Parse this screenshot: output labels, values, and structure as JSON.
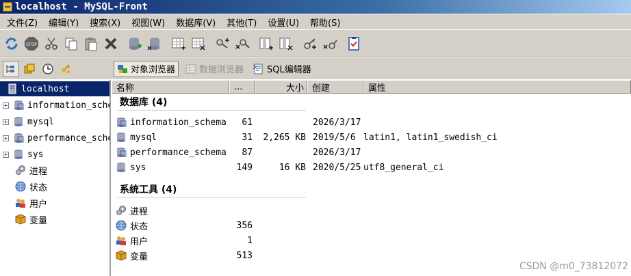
{
  "window": {
    "title": "localhost - MySQL-Front"
  },
  "menu": [
    "文件(Z)",
    "编辑(Y)",
    "搜索(X)",
    "视图(W)",
    "数据库(V)",
    "其他(T)",
    "设置(U)",
    "帮助(S)"
  ],
  "toolbar_icons": [
    "refresh-icon",
    "stop-icon",
    "cut-icon",
    "copy-icon",
    "paste-icon",
    "delete-icon",
    "add-database-icon",
    "drop-database-icon",
    "add-table-icon",
    "drop-table-icon",
    "add-user-icon",
    "drop-user-icon",
    "add-field-icon",
    "drop-field-icon",
    "add-key-icon",
    "drop-key-icon",
    "properties-icon"
  ],
  "view_tabs": [
    {
      "label": "对象浏览器",
      "state": "active"
    },
    {
      "label": "数据浏览器",
      "state": "disabled"
    },
    {
      "label": "SQL编辑器",
      "state": "normal"
    }
  ],
  "tree": {
    "root": "localhost",
    "databases": [
      "information_schema",
      "mysql",
      "performance_schema",
      "sys"
    ],
    "tools": [
      "进程",
      "状态",
      "用户",
      "变量"
    ]
  },
  "columns": {
    "name": "名称",
    "count": "...",
    "size": "大小",
    "created": "创建",
    "props": "属性"
  },
  "groups": {
    "databases_title": "数据库 (4)",
    "tools_title": "系统工具 (4)"
  },
  "database_rows": [
    {
      "name": "information_schema",
      "count": "61",
      "size": "",
      "created": "2026/3/17",
      "props": ""
    },
    {
      "name": "mysql",
      "count": "31",
      "size": "2,265 KB",
      "created": "2019/5/6",
      "props": "latin1, latin1_swedish_ci"
    },
    {
      "name": "performance_schema",
      "count": "87",
      "size": "",
      "created": "2026/3/17",
      "props": ""
    },
    {
      "name": "sys",
      "count": "149",
      "size": "16 KB",
      "created": "2020/5/25",
      "props": "utf8_general_ci"
    }
  ],
  "tool_rows": [
    {
      "name": "进程",
      "count": ""
    },
    {
      "name": "状态",
      "count": "356"
    },
    {
      "name": "用户",
      "count": "1"
    },
    {
      "name": "变量",
      "count": "513"
    }
  ],
  "watermark": "CSDN @m0_73812072",
  "colors": {
    "selection": "#0a246a",
    "chrome": "#d4d0c8",
    "title_start": "#0a246a"
  }
}
